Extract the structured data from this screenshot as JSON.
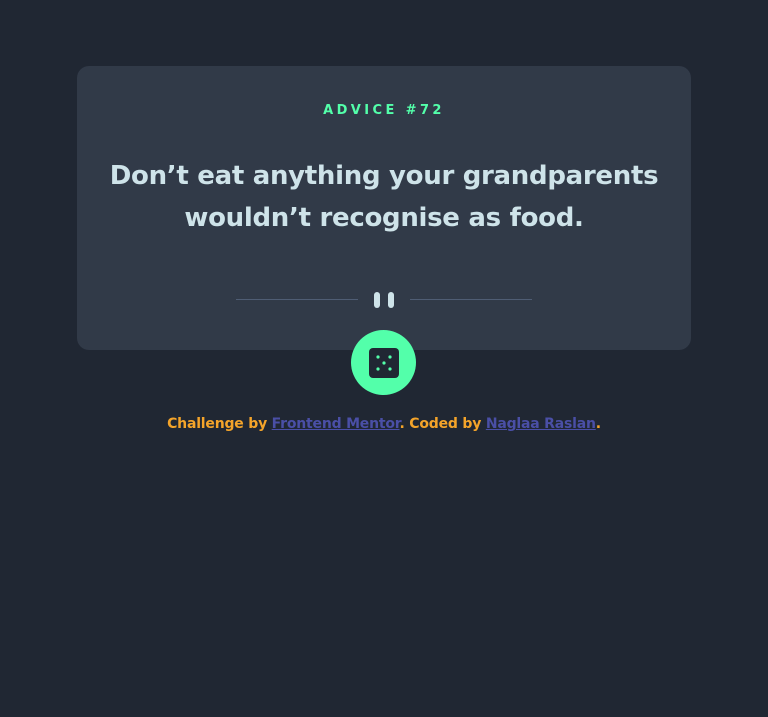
{
  "advice": {
    "id_label": "ADVICE #72",
    "quote": "Don’t eat anything your grandparents wouldn’t recognise as food."
  },
  "dice_button": {
    "icon": "dice-icon",
    "color": "#53ffaa"
  },
  "attribution": {
    "challenge_text": "Challenge by ",
    "challenge_link": "Frontend Mentor",
    "coded_text": ". Coded by ",
    "coder_link": "Naglaa Raslan",
    "end_text": "."
  },
  "colors": {
    "background": "#202733",
    "card": "#313a48",
    "accent": "#53ffaa",
    "quote_text": "#cee3e9",
    "attribution_text": "#f4a42a",
    "link": "#4a4fa6"
  }
}
